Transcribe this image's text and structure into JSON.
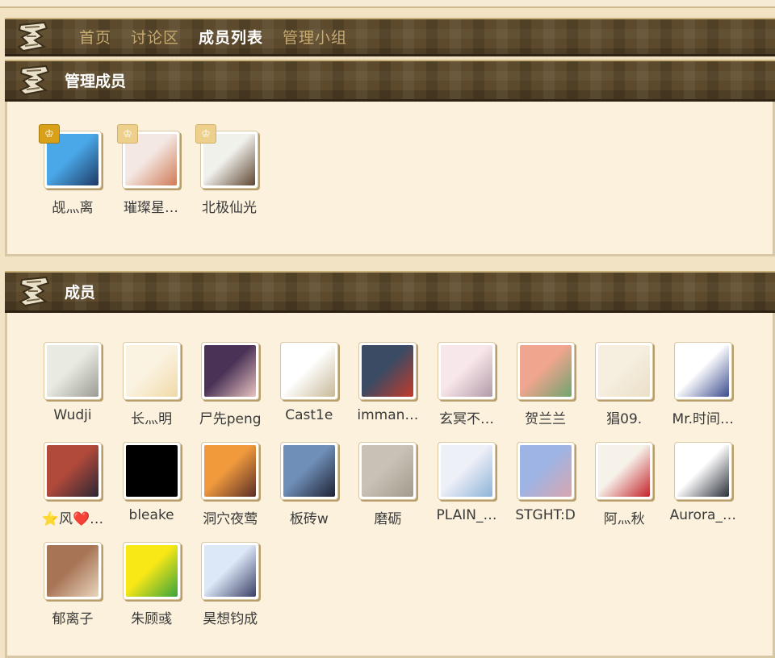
{
  "nav": {
    "items": [
      {
        "label": "首页",
        "active": false
      },
      {
        "label": "讨论区",
        "active": false
      },
      {
        "label": "成员列表",
        "active": true
      },
      {
        "label": "管理小组",
        "active": false
      }
    ]
  },
  "admins": {
    "title": "管理成员",
    "members": [
      {
        "name": "觇灬离",
        "crown": "gold",
        "colors": [
          "#4aa8e8",
          "#1d3a64"
        ]
      },
      {
        "name": "璀璨星…",
        "crown": "light",
        "colors": [
          "#f3e8e4",
          "#d07a55"
        ]
      },
      {
        "name": "北极仙光",
        "crown": "light",
        "colors": [
          "#f1f1ec",
          "#5e4530"
        ]
      }
    ]
  },
  "members": {
    "title": "成员",
    "list": [
      {
        "name": "Wudji",
        "colors": [
          "#e9ebe3",
          "#9b9b93"
        ]
      },
      {
        "name": "长灬明",
        "colors": [
          "#fbf3e2",
          "#f0d9a6"
        ]
      },
      {
        "name": "尸先peng",
        "colors": [
          "#4a3257",
          "#e7c3c0"
        ]
      },
      {
        "name": "Cast1e",
        "colors": [
          "#ffffff",
          "#c7b998"
        ]
      },
      {
        "name": "imman…",
        "colors": [
          "#3b4b63",
          "#c33a2b"
        ]
      },
      {
        "name": "玄冥不…",
        "colors": [
          "#f8e7ea",
          "#b29aa8"
        ]
      },
      {
        "name": "贺兰兰",
        "colors": [
          "#f0a58e",
          "#6fa46e"
        ]
      },
      {
        "name": "猖09.",
        "colors": [
          "#f6efe0",
          "#eadfc8"
        ]
      },
      {
        "name": "Mr.时间…",
        "colors": [
          "#ffffff",
          "#3c4d8f"
        ]
      },
      {
        "name": "⭐风❤️…",
        "colors": [
          "#b24a3b",
          "#2b2633"
        ]
      },
      {
        "name": "bleake",
        "colors": [
          "#000000",
          "#000000"
        ]
      },
      {
        "name": "洞穴夜莺",
        "colors": [
          "#f09a3c",
          "#5a2e28"
        ]
      },
      {
        "name": "板砖w",
        "colors": [
          "#6f8fb8",
          "#1e2233"
        ]
      },
      {
        "name": "磨砺",
        "colors": [
          "#c8c2b6",
          "#a19a8d"
        ]
      },
      {
        "name": "PLAIN_…",
        "colors": [
          "#eef0f7",
          "#8db3d8"
        ]
      },
      {
        "name": "STGHT:D",
        "colors": [
          "#9eb4e4",
          "#d9a6ae"
        ]
      },
      {
        "name": "阿灬秋",
        "colors": [
          "#f6f2ea",
          "#c4222a"
        ]
      },
      {
        "name": "Aurora_…",
        "colors": [
          "#ffffff",
          "#2a2f39"
        ]
      },
      {
        "name": "郁离子",
        "colors": [
          "#a87456",
          "#e8d6bd"
        ]
      },
      {
        "name": "朱顾彧",
        "colors": [
          "#f8e816",
          "#3aa33c"
        ]
      },
      {
        "name": "昊想钧成",
        "colors": [
          "#dce8f8",
          "#3a3f66"
        ]
      }
    ]
  }
}
